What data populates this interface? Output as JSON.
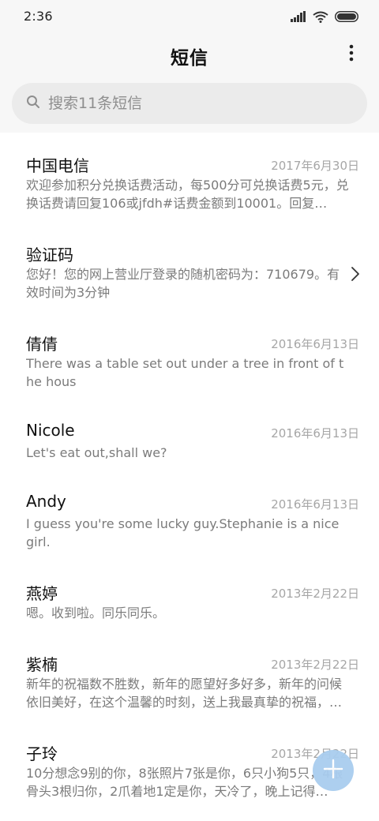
{
  "status_bar": {
    "time": "2:36",
    "icons": [
      "signal-icon",
      "wifi-icon",
      "battery-icon"
    ]
  },
  "header": {
    "title": "短信",
    "more_icon": "more-vertical-icon"
  },
  "search": {
    "placeholder": "搜索11条短信",
    "icon": "search-icon"
  },
  "messages": [
    {
      "name": "中国电信",
      "date": "2017年6月30日",
      "preview": "欢迎参加积分兑换话费活动，每500分可兑换话费5元，兑换话费请回复106或jfdh#话费金额到10001。回复…"
    },
    {
      "name": "验证码",
      "date": "",
      "preview": "您好！您的网上营业厅登录的随机密码为：710679。有效时间为3分钟",
      "trailing_icon": "chevron-right-icon"
    },
    {
      "name": "倩倩",
      "date": "2016年6月13日",
      "preview": "There was a table set out under a tree in front of the hous"
    },
    {
      "name": "Nicole",
      "date": "2016年6月13日",
      "preview": "Let's eat out,shall we?"
    },
    {
      "name": "Andy",
      "date": "2016年6月13日",
      "preview": "I guess you're some lucky guy.Stephanie is a nice girl."
    },
    {
      "name": "燕婷",
      "date": "2013年2月22日",
      "preview": "嗯。收到啦。同乐同乐。"
    },
    {
      "name": "紫楠",
      "date": "2013年2月22日",
      "preview": "新年的祝福数不胜数，新年的愿望好多好多，新年的问候依旧美好，在这个温馨的时刻，送上我最真挚的祝福，…"
    },
    {
      "name": "子玲",
      "date": "2013年2月22日",
      "preview": "10分想念9别的你，8张照片7张是你，6只小狗5只，4根骨头3根归你，2爪着地1定是你，天冷了，晚上记得…"
    }
  ],
  "fab": {
    "icon": "plus-icon",
    "color": "#a9cdef"
  },
  "colors": {
    "background": "#ffffff",
    "header_bg": "#f7f7f7",
    "search_bg": "#ebebeb",
    "date_text": "#a6a6a6",
    "preview_text": "#7b7b7b"
  }
}
